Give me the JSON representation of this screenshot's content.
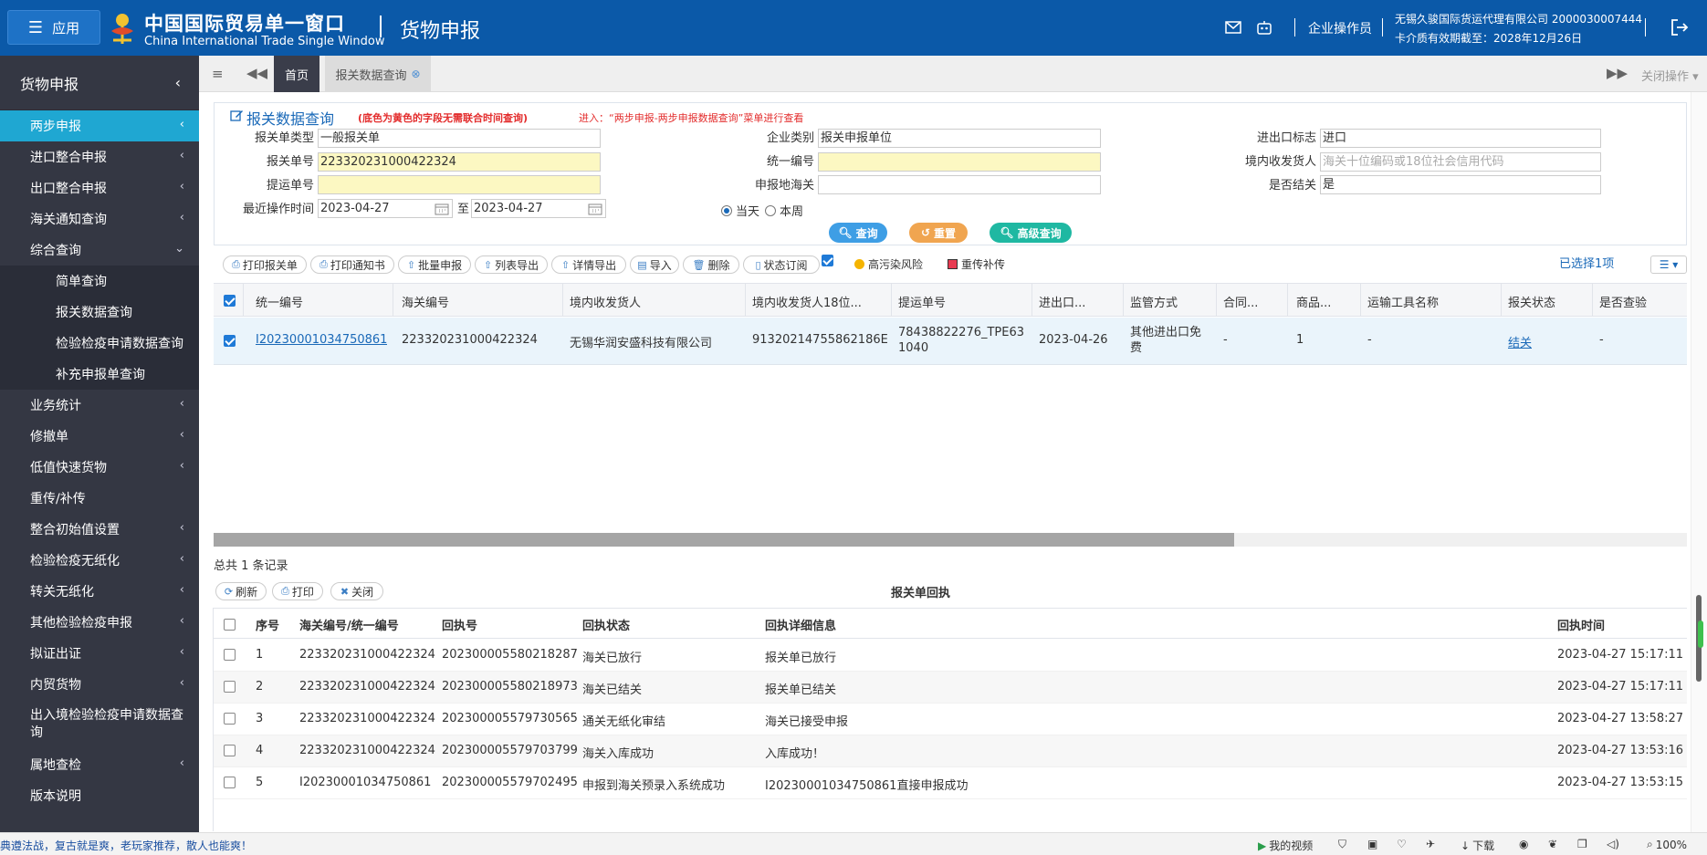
{
  "header": {
    "app_label": "应用",
    "logo_cn": "中国国际贸易单一窗口",
    "logo_en": "China International Trade Single Window",
    "module_title": "货物申报",
    "role": "企业操作员",
    "company": "无锡久骏国际货运代理有限公司 2000030007444",
    "expiry": "卡介质有效期截至：2028年12月26日"
  },
  "sidebar": {
    "title": "货物申报",
    "items": [
      {
        "label": "两步申报"
      },
      {
        "label": "进口整合申报"
      },
      {
        "label": "出口整合申报"
      },
      {
        "label": "海关通知查询"
      },
      {
        "label": "综合查询"
      },
      {
        "label": "简单查询"
      },
      {
        "label": "报关数据查询"
      },
      {
        "label": "检验检疫申请数据查询"
      },
      {
        "label": "补充申报单查询"
      },
      {
        "label": "业务统计"
      },
      {
        "label": "修撤单"
      },
      {
        "label": "低值快速货物"
      },
      {
        "label": "重传/补传"
      },
      {
        "label": "整合初始值设置"
      },
      {
        "label": "检验检疫无纸化"
      },
      {
        "label": "转关无纸化"
      },
      {
        "label": "其他检验检疫申报"
      },
      {
        "label": "拟证出证"
      },
      {
        "label": "内贸货物"
      },
      {
        "label": "出入境检验检疫申请数据查询"
      },
      {
        "label": "属地查检"
      },
      {
        "label": "版本说明"
      }
    ]
  },
  "tabs": {
    "home": "首页",
    "active": "报关数据查询",
    "close_ops": "关闭操作"
  },
  "search": {
    "title": "报关数据查询",
    "note": "(底色为黄色的字段无需联合时间查询)",
    "note2": "进入：“两步申报-两步申报数据查询”菜单进行查看",
    "fields": {
      "decl_type_label": "报关单类型",
      "decl_type_value": "一般报关单",
      "decl_no_label": "报关单号",
      "decl_no_value": "223320231000422324",
      "bill_no_label": "提运单号",
      "last_op_label": "最近操作时间",
      "date_from": "2023-04-27",
      "date_to_label": "至",
      "date_to": "2023-04-27",
      "ent_type_label": "企业类别",
      "ent_type_value": "报关申报单位",
      "unified_no_label": "统一编号",
      "customs_label": "申报地海关",
      "ie_flag_label": "进出口标志",
      "ie_flag_value": "进口",
      "consignee_label": "境内收发货人",
      "consignee_placeholder": "海关十位编码或18位社会信用代码",
      "closed_label": "是否结关",
      "closed_value": "是",
      "radio_today": "当天",
      "radio_week": "本周"
    },
    "buttons": {
      "query": "查询",
      "reset": "重置",
      "advanced": "高级查询"
    }
  },
  "toolbar": {
    "print_decl": "打印报关单",
    "print_notice": "打印通知书",
    "batch_declare": "批量申报",
    "list_export": "列表导出",
    "detail_export": "详情导出",
    "import": "导入",
    "delete": "删除",
    "status_sub": "状态订阅",
    "high_risk": "高污染风险",
    "resend": "重传补传",
    "selected": "已选择1项"
  },
  "main_table": {
    "headers": [
      "统一编号",
      "海关编号",
      "境内收发货人",
      "境内收发货人18位...",
      "提运单号",
      "进出口...",
      "监管方式",
      "合同...",
      "商品...",
      "运输工具名称",
      "报关状态",
      "是否查验"
    ],
    "rows": [
      [
        "I20230001034750861",
        "223320231000422324",
        "无锡华润安盛科技有限公司",
        "91320214755862186E",
        "78438822276_TPE631040",
        "2023-04-26",
        "其他进出口免费",
        "-",
        "1",
        "-",
        "结关",
        "-"
      ]
    ],
    "total": "总共 1 条记录"
  },
  "receipt": {
    "title": "报关单回执",
    "buttons": {
      "refresh": "刷新",
      "print": "打印",
      "close": "关闭"
    },
    "headers": [
      "序号",
      "海关编号/统一编号",
      "回执号",
      "回执状态",
      "回执详细信息",
      "回执时间"
    ],
    "rows": [
      [
        "1",
        "223320231000422324",
        "202300005580218287",
        "海关已放行",
        "报关单已放行",
        "2023-04-27 15:17:11"
      ],
      [
        "2",
        "223320231000422324",
        "202300005580218973",
        "海关已结关",
        "报关单已结关",
        "2023-04-27 15:17:11"
      ],
      [
        "3",
        "223320231000422324",
        "202300005579730565",
        "通关无纸化审结",
        "海关已接受申报",
        "2023-04-27 13:58:27"
      ],
      [
        "4",
        "223320231000422324",
        "202300005579703799",
        "海关入库成功",
        "入库成功！",
        "2023-04-27 13:53:16"
      ],
      [
        "5",
        "I20230001034750861",
        "202300005579702495",
        "申报到海关预录入系统成功",
        "I20230001034750861直接申报成功",
        "2023-04-27 13:53:15"
      ]
    ]
  },
  "statusbar": {
    "ticker": "典遵法战，复古就是爽，老玩家推荐，散人也能爽！",
    "video": "我的视频",
    "download": "下载",
    "zoom": "100%"
  }
}
